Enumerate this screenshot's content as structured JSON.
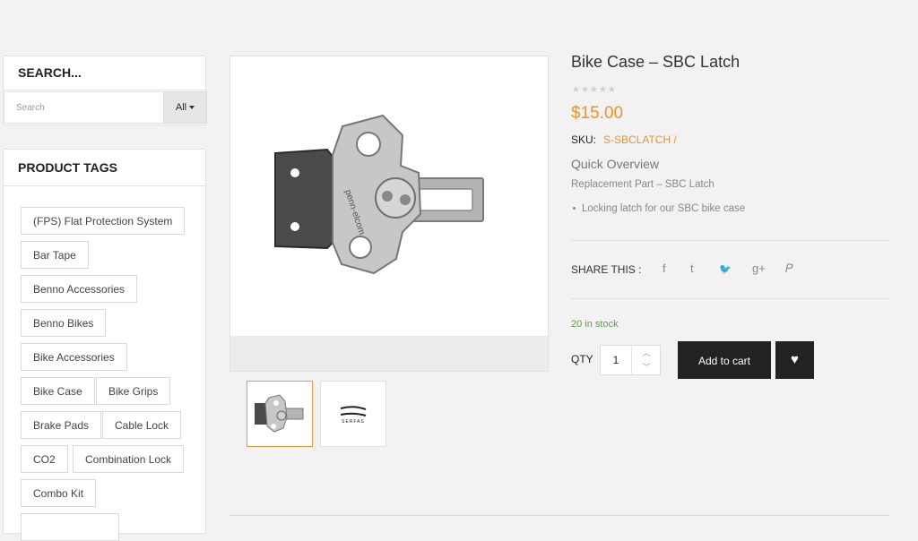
{
  "search_widget": {
    "title": "SEARCH...",
    "placeholder": "Search",
    "category": "All"
  },
  "tags_widget": {
    "title": "PRODUCT TAGS",
    "tags": [
      "(FPS) Flat Protection System",
      "Bar Tape",
      "Benno Accessories",
      "Benno Bikes",
      "Bike Accessories",
      "Bike Case",
      "Bike Grips",
      "Brake Pads",
      "Cable Lock",
      "CO2",
      "Combination Lock",
      "Combo Kit"
    ]
  },
  "product": {
    "title": "Bike Case – SBC Latch",
    "rating_stars": "★★★★★",
    "price": "$15.00",
    "sku_label": "SKU:",
    "sku_value": "S-SBCLATCH /",
    "overview_title": "Quick Overview",
    "overview_text": "Replacement Part – SBC Latch",
    "bullets": [
      "Locking latch for our SBC bike case"
    ],
    "share_label": "SHARE THIS :",
    "share_icons": [
      "f",
      "t",
      "🐦",
      "g+",
      "𝑃"
    ],
    "stock": "20 in stock",
    "qty_label": "QTY",
    "qty_value": "1",
    "add_to_cart": "Add to cart",
    "wishlist_icon": "♥"
  },
  "thumbnail_logo_text": "SERFAS",
  "colors": {
    "accent": "#e8942e",
    "in_stock": "#5e9c48",
    "button": "#222222"
  }
}
